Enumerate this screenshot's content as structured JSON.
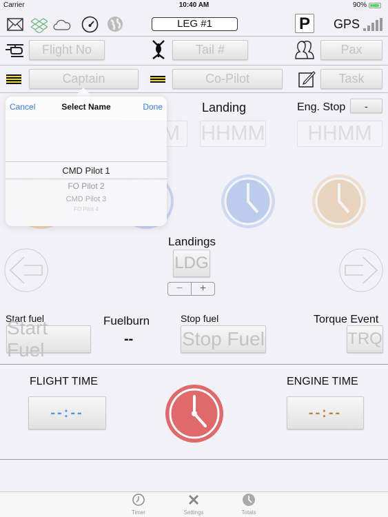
{
  "status_bar": {
    "carrier": "Carrier",
    "time": "10:40 AM",
    "battery": "90%"
  },
  "toolbar": {
    "leg": "LEG #1",
    "parking": "P",
    "gps": "GPS",
    "icons": [
      "mail-icon",
      "dropbox-icon",
      "cloud-icon",
      "speedometer-icon",
      "globe-icon"
    ]
  },
  "fields": {
    "flight_no": "Flight No",
    "tail": "Tail #",
    "pax": "Pax",
    "captain": "Captain",
    "copilot": "Co-Pilot",
    "task": "Task"
  },
  "times": {
    "landing_label": "Landing",
    "eng_stop_label": "Eng. Stop",
    "eng_stop_value": "-",
    "landing_placeholder": "HHMM",
    "eng_stop_placeholder": "HHMM",
    "hidden_placeholder_tail": "M"
  },
  "picker": {
    "cancel": "Cancel",
    "title": "Select Name",
    "done": "Done",
    "options": [
      "CMD Pilot 1",
      "FO Pilot 2",
      "CMD Pilot 3",
      "FO Pilot 4"
    ],
    "selected": "CMD Pilot 1"
  },
  "landings": {
    "label": "Landings",
    "button": "LDG",
    "minus": "−",
    "plus": "+"
  },
  "fuel": {
    "start_label": "Start fuel",
    "start_button": "Start Fuel",
    "burn_label": "Fuelburn",
    "burn_value": "--",
    "stop_label": "Stop fuel",
    "stop_button": "Stop Fuel",
    "torque_label": "Torque Event",
    "torque_button": "TRQ"
  },
  "totals": {
    "flight_label": "FLIGHT TIME",
    "flight_value": "--:--",
    "engine_label": "ENGINE TIME",
    "engine_value": "--:--",
    "flight_color": "#5b8fe8",
    "engine_color": "#b8813a",
    "timer_color": "#e0696b"
  },
  "tabs": [
    {
      "label": "Timer"
    },
    {
      "label": "Settings"
    },
    {
      "label": "Totals"
    }
  ]
}
